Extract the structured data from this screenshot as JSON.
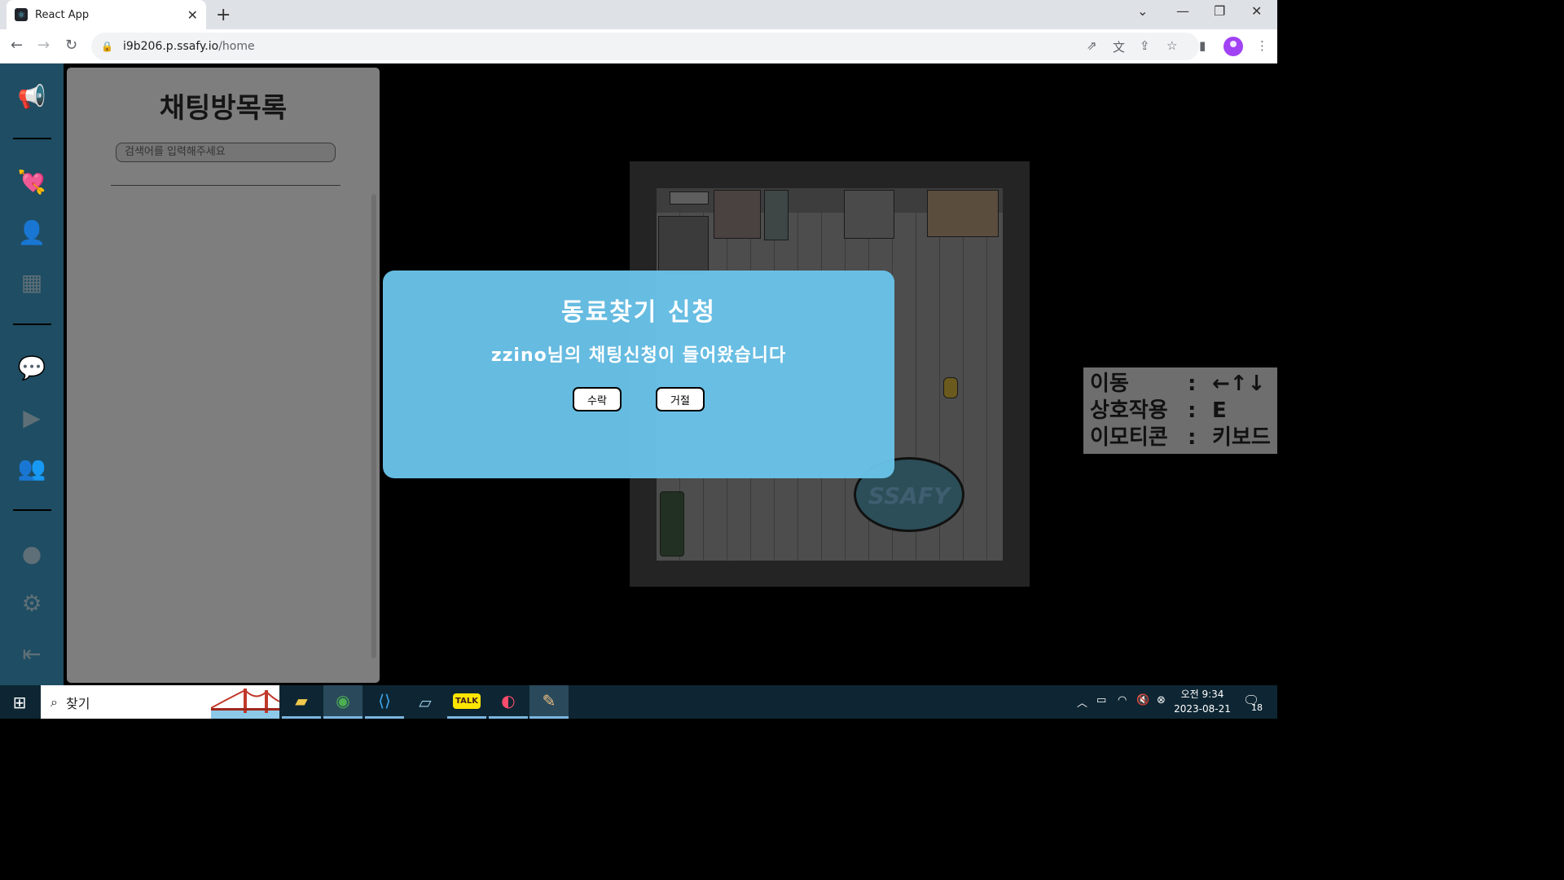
{
  "browser": {
    "tab_title": "React App",
    "tab_close": "✕",
    "new_tab": "+",
    "url_host": "i9b206.p.ssafy.io",
    "url_path": "/home"
  },
  "sidebar": {
    "items": [
      {
        "name": "announce",
        "icon": "megaphone-icon",
        "glyph": "📢"
      },
      {
        "name": "match",
        "icon": "heart-arrow-icon",
        "glyph": "💘"
      },
      {
        "name": "add-friend",
        "icon": "user-plus-icon",
        "glyph": "👤"
      },
      {
        "name": "board",
        "icon": "board-icon",
        "glyph": "▦"
      },
      {
        "name": "chat",
        "icon": "chat-icon",
        "glyph": "💬"
      },
      {
        "name": "video",
        "icon": "video-icon",
        "glyph": "▶"
      },
      {
        "name": "friends",
        "icon": "group-icon",
        "glyph": "👥"
      },
      {
        "name": "profile",
        "icon": "profile-icon",
        "glyph": "●"
      },
      {
        "name": "settings",
        "icon": "gear-icon",
        "glyph": "⚙"
      },
      {
        "name": "logout",
        "icon": "logout-icon",
        "glyph": "⇤"
      }
    ]
  },
  "chat_panel": {
    "title": "채팅방목록",
    "search_placeholder": "검색어를 입력해주세요"
  },
  "game": {
    "rug_text": "SSAFY"
  },
  "key_help": {
    "rows": [
      {
        "key": "이동",
        "colon": ":",
        "value": "←↑↓"
      },
      {
        "key": "상호작용",
        "colon": ":",
        "value": "E"
      },
      {
        "key": "이모티콘",
        "colon": ":",
        "value": "키보드"
      }
    ]
  },
  "modal": {
    "title": "동료찾기 신청",
    "message": "zzino님의 채팅신청이 들어왔습니다",
    "accept_label": "수락",
    "reject_label": "거절"
  },
  "taskbar": {
    "search_label": "찾기",
    "clock_period_time": "오전 9:34",
    "clock_date": "2023-08-21",
    "notification_count": "18"
  },
  "colors": {
    "sidebar_bg": "#1f4d63",
    "modal_bg": "#6ac3e9",
    "chat_panel_bg": "#7e7e7e"
  }
}
